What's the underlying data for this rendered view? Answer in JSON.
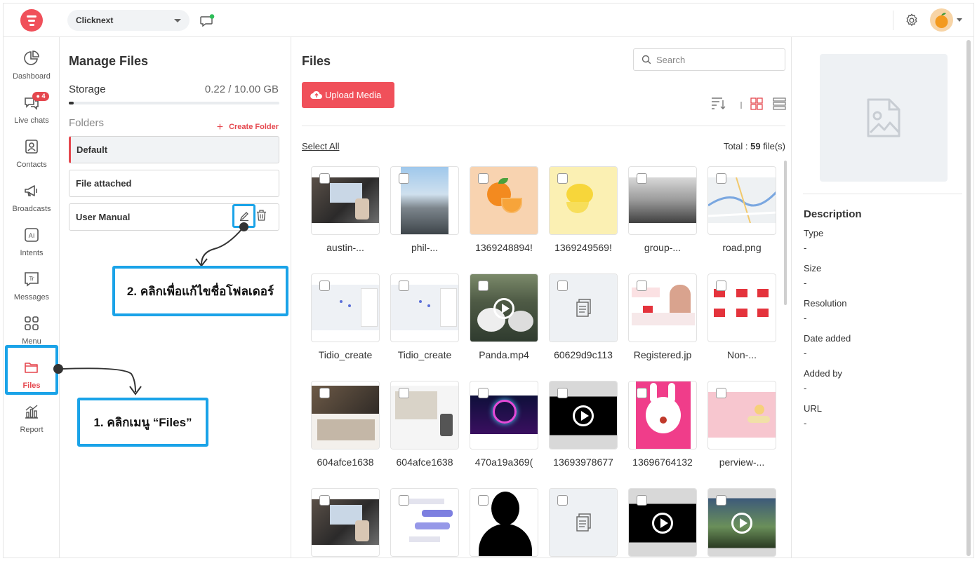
{
  "topbar": {
    "workspace": "Clicknext"
  },
  "nav": {
    "items": [
      {
        "label": "Dashboard"
      },
      {
        "label": "Live chats",
        "badge": "4"
      },
      {
        "label": "Contacts"
      },
      {
        "label": "Broadcasts"
      },
      {
        "label": "Intents"
      },
      {
        "label": "Messages"
      },
      {
        "label": "Menu"
      },
      {
        "label": "Files"
      },
      {
        "label": "Report"
      }
    ]
  },
  "manage": {
    "title": "Manage Files",
    "storage_label": "Storage",
    "storage_value": "0.22 / 10.00 GB",
    "storage_used_fraction": 0.022,
    "folders_label": "Folders",
    "create_folder": "Create Folder",
    "folders": [
      {
        "name": "Default",
        "selected": true
      },
      {
        "name": "File attached",
        "selected": false
      },
      {
        "name": "User Manual",
        "selected": false
      }
    ]
  },
  "callouts": {
    "step1": "1. คลิกเมนู “Files”",
    "step2": "2. คลิกเพื่อแก้ไขชื่อโฟลเดอร์"
  },
  "files": {
    "title": "Files",
    "search_placeholder": "Search",
    "upload_label": "Upload Media",
    "select_all": "Select All",
    "total_prefix": "Total :",
    "total_count": "59",
    "total_suffix": "file(s)",
    "items": [
      {
        "name": "austin-...",
        "kind": "laptop"
      },
      {
        "name": "phil-...",
        "kind": "city"
      },
      {
        "name": "1369248894!",
        "kind": "orange"
      },
      {
        "name": "1369249569!",
        "kind": "lemon"
      },
      {
        "name": "group-...",
        "kind": "meeting"
      },
      {
        "name": "road.png",
        "kind": "map"
      },
      {
        "name": "Tidio_create",
        "kind": "screenshot"
      },
      {
        "name": "Tidio_create",
        "kind": "screenshot"
      },
      {
        "name": "Panda.mp4",
        "kind": "panda"
      },
      {
        "name": "60629d9c113",
        "kind": "document"
      },
      {
        "name": "Registered.jp",
        "kind": "promo"
      },
      {
        "name": "Non-...",
        "kind": "promo2"
      },
      {
        "name": "604afce1638",
        "kind": "web"
      },
      {
        "name": "604afce1638",
        "kind": "web2"
      },
      {
        "name": "470a19a369(",
        "kind": "neon"
      },
      {
        "name": "13693978677",
        "kind": "video"
      },
      {
        "name": "13696764132",
        "kind": "bunny"
      },
      {
        "name": "perview-...",
        "kind": "pink"
      },
      {
        "name": "",
        "kind": "laptop"
      },
      {
        "name": "",
        "kind": "chat"
      },
      {
        "name": "",
        "kind": "person"
      },
      {
        "name": "",
        "kind": "document"
      },
      {
        "name": "",
        "kind": "video"
      },
      {
        "name": "",
        "kind": "video-land"
      }
    ]
  },
  "detail": {
    "description_title": "Description",
    "fields": [
      {
        "label": "Type",
        "value": "-"
      },
      {
        "label": "Size",
        "value": "-"
      },
      {
        "label": "Resolution",
        "value": "-"
      },
      {
        "label": "Date added",
        "value": "-"
      },
      {
        "label": "Added by",
        "value": "-"
      },
      {
        "label": "URL",
        "value": "-"
      }
    ]
  }
}
